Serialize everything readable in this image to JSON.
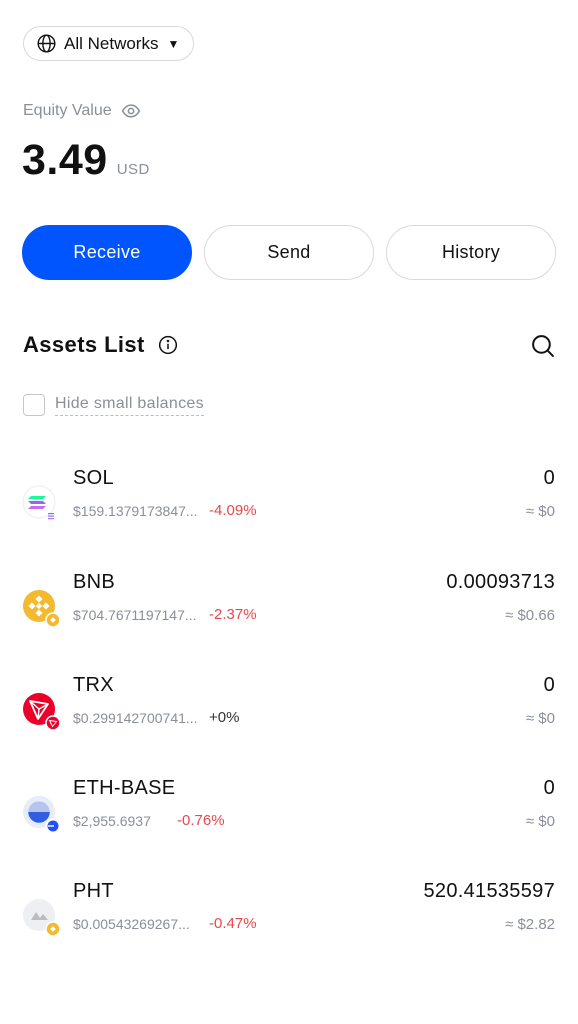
{
  "network": {
    "label": "All Networks",
    "icon": "globe-icon"
  },
  "equity": {
    "label": "Equity Value",
    "value": "3.49",
    "unit": "USD"
  },
  "actions": {
    "receive": "Receive",
    "send": "Send",
    "history": "History",
    "primary_color": "#0055ff"
  },
  "assets": {
    "title": "Assets List",
    "hide_small_label": "Hide small balances",
    "hide_small_checked": false,
    "items": [
      {
        "symbol": "SOL",
        "price": "$159.1379173847...",
        "change": "-4.09%",
        "amount": "0",
        "fiat": "≈ $0",
        "icon": "sol-coin-icon"
      },
      {
        "symbol": "BNB",
        "price": "$704.7671197147...",
        "change": "-2.37%",
        "amount": "0.00093713",
        "fiat": "≈ $0.66",
        "icon": "bnb-coin-icon"
      },
      {
        "symbol": "TRX",
        "price": "$0.299142700741...",
        "change": "+0%",
        "amount": "0",
        "fiat": "≈ $0",
        "icon": "trx-coin-icon"
      },
      {
        "symbol": "ETH-BASE",
        "price": "$2,955.6937",
        "change": "-0.76%",
        "amount": "0",
        "fiat": "≈ $0",
        "icon": "base-coin-icon"
      },
      {
        "symbol": "PHT",
        "price": "$0.00543269267...",
        "change": "-0.47%",
        "amount": "520.41535597",
        "fiat": "≈ $2.82",
        "icon": "pht-coin-icon"
      }
    ]
  },
  "colors": {
    "negative": "#e5484d",
    "muted": "#8a8f98"
  }
}
